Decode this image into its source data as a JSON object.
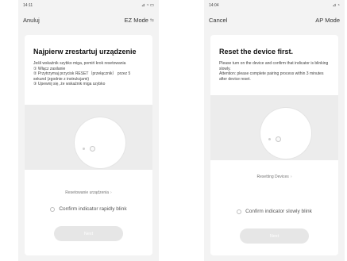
{
  "left": {
    "status": {
      "time": "14:11",
      "icons": "⊿ ◔ ▭"
    },
    "nav": {
      "back": "Anuluj",
      "mode": "EZ Mode",
      "chevron": "⇆"
    },
    "title": "Najpierw zrestartuj urządzenie",
    "instructions": [
      "Jeśli wskaźnik szybko miga, pomiń krok resetowania",
      "① Włącz zasilanie",
      "② Przytrzymaj przycisk RESET（przełącznik） przez 5 sekund (zgodnie z instrukcjami)",
      "③ Upewnij się, że wskaźnik miga szybko"
    ],
    "action_link": "Resetowanie urządzenia",
    "confirm": "Confirm indicator rapidly blink",
    "next": "Next"
  },
  "right": {
    "status": {
      "time": "14:04",
      "icons": "⊿ ◔"
    },
    "nav": {
      "back": "Cancel",
      "mode": "AP Mode"
    },
    "title": "Reset the device first.",
    "instructions": [
      "Please turn on the device and confirm that indicator is blinking slowly.",
      "Attention: please complete pairing process within 3 minutes after device reset."
    ],
    "action_link": "Resetting Devices",
    "confirm": "Confirm indicator slowly blink",
    "next": "Next"
  },
  "colors": {
    "screen_bg": "#f3f3f3",
    "card_bg": "#ffffff",
    "button_disabled": "#e6e6e6"
  }
}
